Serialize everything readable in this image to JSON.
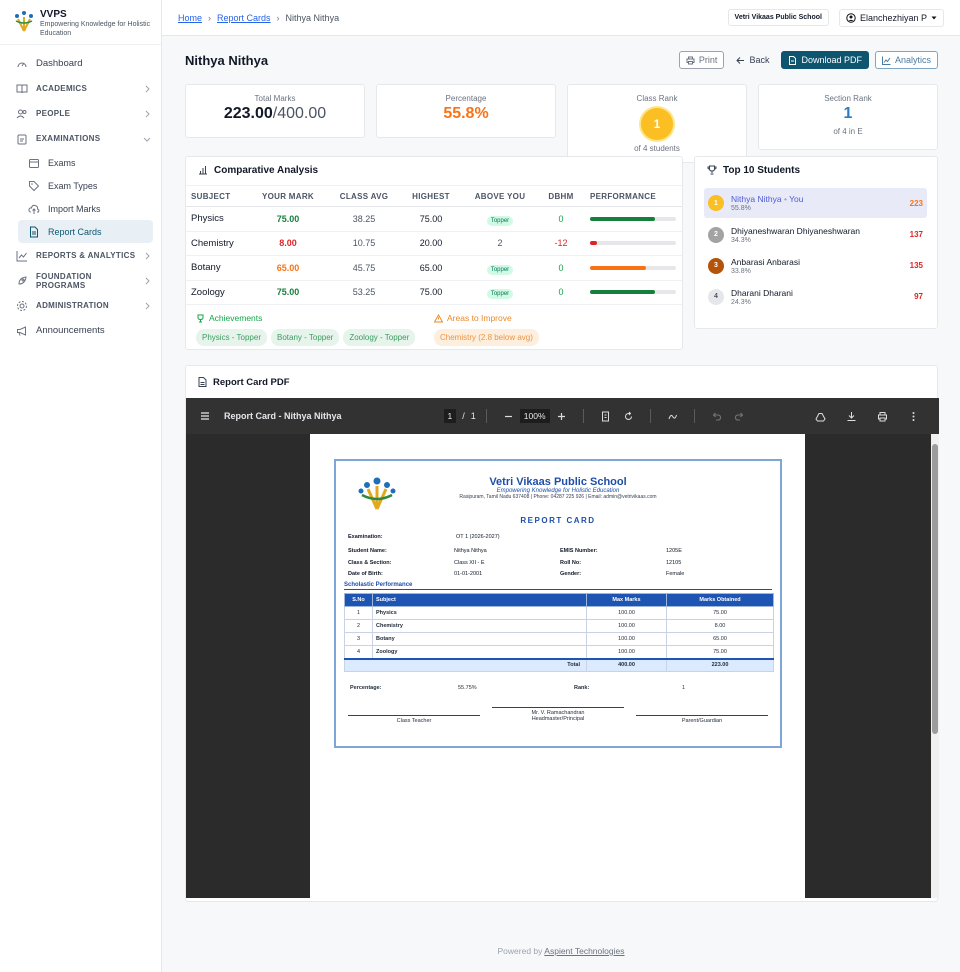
{
  "brand": {
    "name": "VVPS",
    "tagline": "Empowering Knowledge for Holistic Education"
  },
  "sidebar": {
    "items": [
      {
        "label": "Dashboard"
      },
      {
        "label": "ACADEMICS"
      },
      {
        "label": "PEOPLE"
      },
      {
        "label": "EXAMINATIONS"
      },
      {
        "label": "REPORTS & ANALYTICS"
      },
      {
        "label": "FOUNDATION PROGRAMS"
      },
      {
        "label": "ADMINISTRATION"
      },
      {
        "label": "Announcements"
      }
    ],
    "exam_sub": [
      {
        "label": "Exams"
      },
      {
        "label": "Exam Types"
      },
      {
        "label": "Import Marks"
      },
      {
        "label": "Report Cards"
      }
    ]
  },
  "breadcrumb": {
    "home": "Home",
    "report_cards": "Report Cards",
    "current": "Nithya Nithya"
  },
  "topbar": {
    "school": "Vetri Vikaas Public School",
    "user": "Elanchezhiyan P"
  },
  "page": {
    "title": "Nithya Nithya",
    "print": "Print",
    "back": "Back",
    "download": "Download PDF",
    "analytics": "Analytics"
  },
  "stats": {
    "total_label": "Total Marks",
    "total_value": "223.00",
    "total_max": "/400.00",
    "pct_label": "Percentage",
    "pct_value": "55.8%",
    "class_rank_label": "Class Rank",
    "class_rank": "1",
    "class_rank_sub": "of 4 students",
    "section_rank_label": "Section Rank",
    "section_rank": "1",
    "section_rank_sub": "of 4 in E"
  },
  "comparative": {
    "title": "Comparative Analysis",
    "headers": [
      "SUBJECT",
      "YOUR MARK",
      "CLASS AVG",
      "HIGHEST",
      "ABOVE YOU",
      "DBHM",
      "PERFORMANCE"
    ],
    "rows": [
      {
        "subject": "Physics",
        "mark": "75.00",
        "avg": "38.25",
        "highest": "75.00",
        "above": "Topper",
        "dbhm": "0",
        "perf": 0.75,
        "color": "#15803d"
      },
      {
        "subject": "Chemistry",
        "mark": "8.00",
        "avg": "10.75",
        "highest": "20.00",
        "above": "2",
        "dbhm": "-12",
        "perf": 0.08,
        "color": "#dc2626"
      },
      {
        "subject": "Botany",
        "mark": "65.00",
        "avg": "45.75",
        "highest": "65.00",
        "above": "Topper",
        "dbhm": "0",
        "perf": 0.65,
        "color": "#f97316"
      },
      {
        "subject": "Zoology",
        "mark": "75.00",
        "avg": "53.25",
        "highest": "75.00",
        "above": "Topper",
        "dbhm": "0",
        "perf": 0.75,
        "color": "#15803d"
      }
    ],
    "achievements_title": "Achievements",
    "achievements": [
      "Physics - Topper",
      "Botany - Topper",
      "Zoology - Topper"
    ],
    "improve_title": "Areas to Improve",
    "improve": [
      "Chemistry (2.8 below avg)"
    ]
  },
  "top10": {
    "title": "Top 10 Students",
    "you_label": "You",
    "students": [
      {
        "rank": "1",
        "name": "Nithya Nithya",
        "pct": "55.8%",
        "score": "223"
      },
      {
        "rank": "2",
        "name": "Dhiyaneshwaran Dhiyaneshwaran",
        "pct": "34.3%",
        "score": "137"
      },
      {
        "rank": "3",
        "name": "Anbarasi Anbarasi",
        "pct": "33.8%",
        "score": "135"
      },
      {
        "rank": "4",
        "name": "Dharani Dharani",
        "pct": "24.3%",
        "score": "97"
      }
    ]
  },
  "pdf": {
    "section_title": "Report Card PDF",
    "viewer_title": "Report Card - Nithya Nithya",
    "page": "1",
    "pages": "1",
    "zoom": "100%",
    "doc": {
      "school": "Vetri Vikaas Public School",
      "tagline": "Empowering Knowledge for Holistic Education",
      "address": "Rasipuram, Tamil Nadu 637408 | Phone: 04287 225 926 | Email: admin@vetrivikaas.com",
      "title": "REPORT CARD",
      "exam_label": "Examination:",
      "exam_value": "OT 1 (2026-2027)",
      "student_label": "Student Name:",
      "student_value": "Nithya Nithya",
      "emis_label": "EMIS Number:",
      "emis_value": "1205E",
      "class_label": "Class & Section:",
      "class_value": "Class XII - E",
      "roll_label": "Roll No:",
      "roll_value": "12105",
      "dob_label": "Date of Birth:",
      "dob_value": "01-01-2001",
      "gender_label": "Gender:",
      "gender_value": "Female",
      "section": "Scholastic Performance",
      "headers": [
        "S.No",
        "Subject",
        "Max Marks",
        "Marks Obtained"
      ],
      "rows": [
        {
          "no": "1",
          "subject": "Physics",
          "max": "100.00",
          "obt": "75.00"
        },
        {
          "no": "2",
          "subject": "Chemistry",
          "max": "100.00",
          "obt": "8.00"
        },
        {
          "no": "3",
          "subject": "Botany",
          "max": "100.00",
          "obt": "65.00"
        },
        {
          "no": "4",
          "subject": "Zoology",
          "max": "100.00",
          "obt": "75.00"
        }
      ],
      "total_label": "Total",
      "total_max": "400.00",
      "total_obt": "223.00",
      "pct_label": "Percentage:",
      "pct_value": "55.75%",
      "rank_label": "Rank:",
      "rank_value": "1",
      "sig1": "Class Teacher",
      "sig2a": "Mr. V. Ramachandran",
      "sig2b": "Headmaster/Principal",
      "sig3": "Parent/Guardian"
    }
  },
  "footer": {
    "prefix": "Powered by",
    "company": "Aspient Technologies"
  }
}
